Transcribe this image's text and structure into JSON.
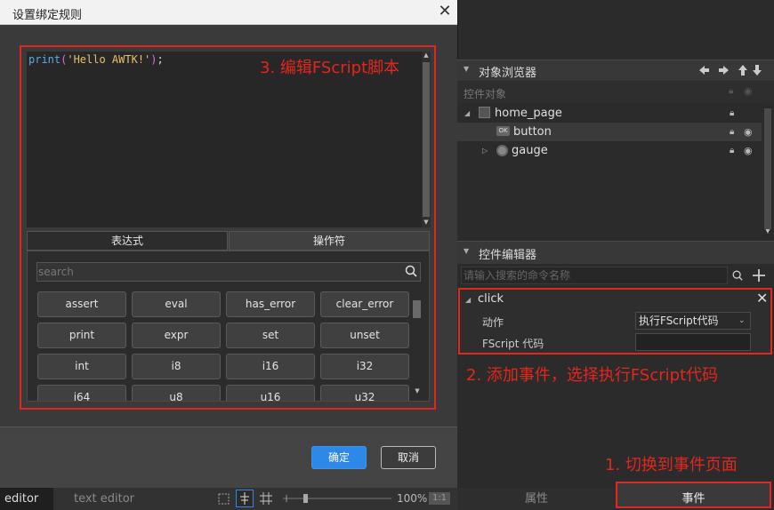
{
  "dialog": {
    "title": "设置绑定规则",
    "code": "print('Hello AWTK!');",
    "tabs": [
      "表达式",
      "操作符"
    ],
    "search_placeholder": "search",
    "functions": [
      "assert",
      "eval",
      "has_error",
      "clear_error",
      "print",
      "expr",
      "set",
      "unset",
      "int",
      "i8",
      "i16",
      "i32",
      "i64",
      "u8",
      "u16",
      "u32"
    ],
    "ok_label": "确定",
    "cancel_label": "取消"
  },
  "annotations": {
    "step1": "1. 切换到事件页面",
    "step2": "2. 添加事件，选择执行FScript代码",
    "step3": "3. 编辑FScript脚本"
  },
  "statusbar": {
    "editor_tab": "editor",
    "text_editor_tab": "text editor",
    "zoom": "100%",
    "ratio": "1:1"
  },
  "object_browser": {
    "title": "对象浏览器",
    "column_label": "控件对象",
    "tree": [
      {
        "label": "home_page",
        "level": 0,
        "expanded": true,
        "icon": "window-icon"
      },
      {
        "label": "button",
        "level": 1,
        "icon": "button-icon",
        "badge": "OK"
      },
      {
        "label": "gauge",
        "level": 1,
        "expanded": false,
        "icon": "gauge-icon"
      }
    ]
  },
  "command_editor": {
    "title": "控件编辑器",
    "search_placeholder": "请输入搜索的命令名称",
    "event": {
      "name": "click",
      "action_label": "动作",
      "action_value": "执行FScript代码",
      "script_label": "FScript 代码"
    }
  },
  "bottom_tabs": {
    "properties": "属性",
    "events": "事件"
  },
  "colors": {
    "annotation": "#e3261e",
    "ok_button": "#2d88e8"
  }
}
